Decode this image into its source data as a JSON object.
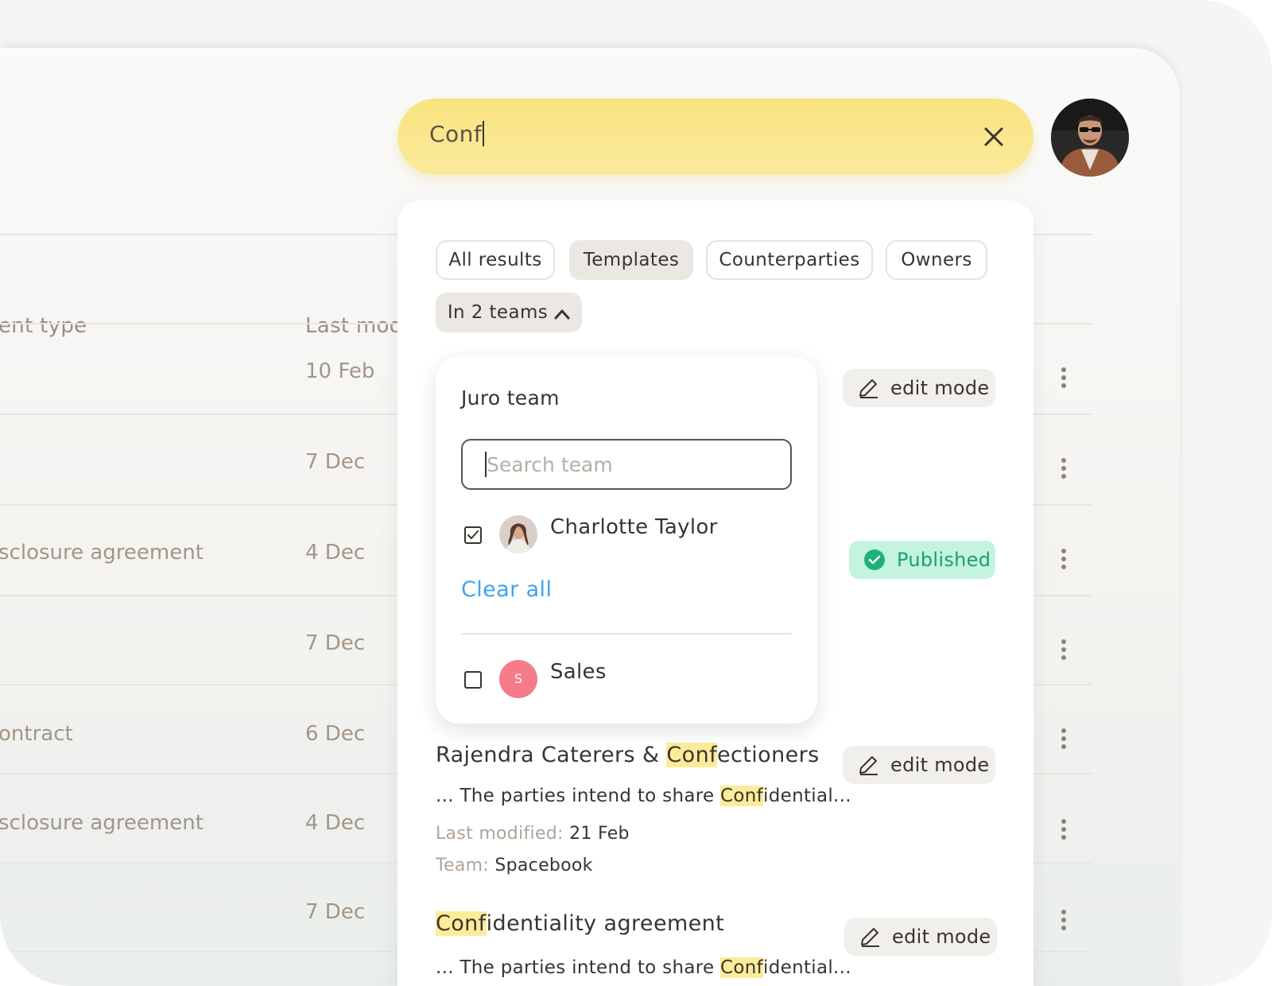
{
  "search": {
    "query": "Conf"
  },
  "table": {
    "headers": {
      "type": "ent type",
      "modified": "Last mod"
    },
    "rows": [
      {
        "type": "",
        "date": "10 Feb"
      },
      {
        "type": "",
        "date": "7 Dec"
      },
      {
        "type": "sclosure agreement",
        "date": "4 Dec"
      },
      {
        "type": "",
        "date": "7 Dec"
      },
      {
        "type": "ontract",
        "date": "6 Dec"
      },
      {
        "type": "sclosure agreement",
        "date": "4 Dec"
      },
      {
        "type": "",
        "date": "7 Dec"
      }
    ]
  },
  "filters": {
    "chips": [
      "All results",
      "Templates",
      "Counterparties",
      "Owners"
    ],
    "active": "Templates",
    "teams_chip": "In 2 teams"
  },
  "team_dropdown": {
    "title": "Juro team",
    "search_placeholder": "Search team",
    "members": [
      {
        "name": "Charlotte Taylor",
        "checked": true
      },
      {
        "name": "Sales",
        "checked": false,
        "initial": "S"
      }
    ],
    "clear_all": "Clear all"
  },
  "results": [
    {
      "title_hl": "Conf",
      "title_pre": "Rajendra Caterers & ",
      "title_post": "ectioners",
      "snippet_pre": "... The parties intend to share ",
      "snippet_hl": "Conf",
      "snippet_post": "idential...",
      "meta": [
        {
          "label": "Last modified:",
          "value": "21 Feb"
        },
        {
          "label": "Team:",
          "value": "Spacebook"
        }
      ]
    },
    {
      "title_hl": "Conf",
      "title_post": "identiality agreement",
      "snippet_pre": "... The parties intend to share ",
      "snippet_hl": "Conf",
      "snippet_post": "idential..."
    }
  ],
  "actions": {
    "edit_mode": "edit mode",
    "published": "Published"
  },
  "colors": {
    "search_bg": "#fae37f",
    "highlight": "#fcec9a",
    "published_bg": "#c4f3df",
    "published_text": "#1d9f6c",
    "link": "#3ea4ec",
    "sales_avatar": "#f57a8a"
  },
  "icons": [
    "close-icon",
    "chevron-up-icon",
    "pencil-icon",
    "check-circle-icon",
    "checkbox-checked-icon",
    "more-vertical-icon"
  ]
}
